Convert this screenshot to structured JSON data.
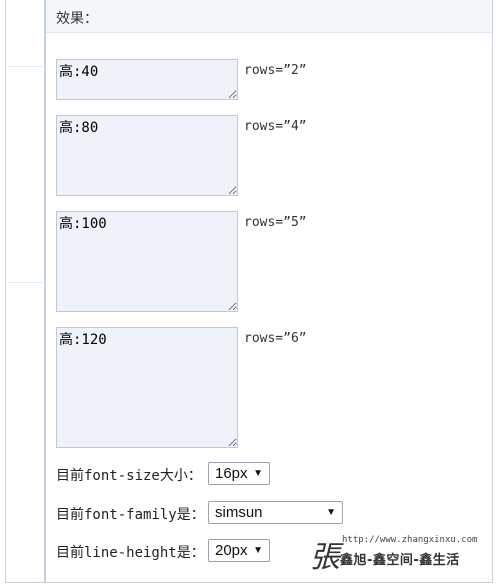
{
  "header": {
    "title": "效果："
  },
  "textareas": [
    {
      "value": "高:40",
      "rows_label": "rows=”2”"
    },
    {
      "value": "高:80",
      "rows_label": "rows=”4”"
    },
    {
      "value": "高:100",
      "rows_label": "rows=”5”"
    },
    {
      "value": "高:120",
      "rows_label": "rows=”6”"
    }
  ],
  "controls": {
    "font_size": {
      "label": "目前font-size大小：",
      "value": "16px"
    },
    "font_family": {
      "label": "目前font-family是：",
      "value": "simsun"
    },
    "line_height": {
      "label": "目前line-height是：",
      "value": "20px"
    }
  },
  "watermark": {
    "glyph": "張",
    "url": "http://www.zhangxinxu.com",
    "tagline": "鑫旭-鑫空间-鑫生活"
  },
  "colors": {
    "textarea_bg": "#eef2fa",
    "header_bg": "#f3f6fa",
    "rule": "#c6d1de"
  },
  "icons": {
    "select_arrow": "triangle-down",
    "resize_grip": "diagonal-lines"
  }
}
